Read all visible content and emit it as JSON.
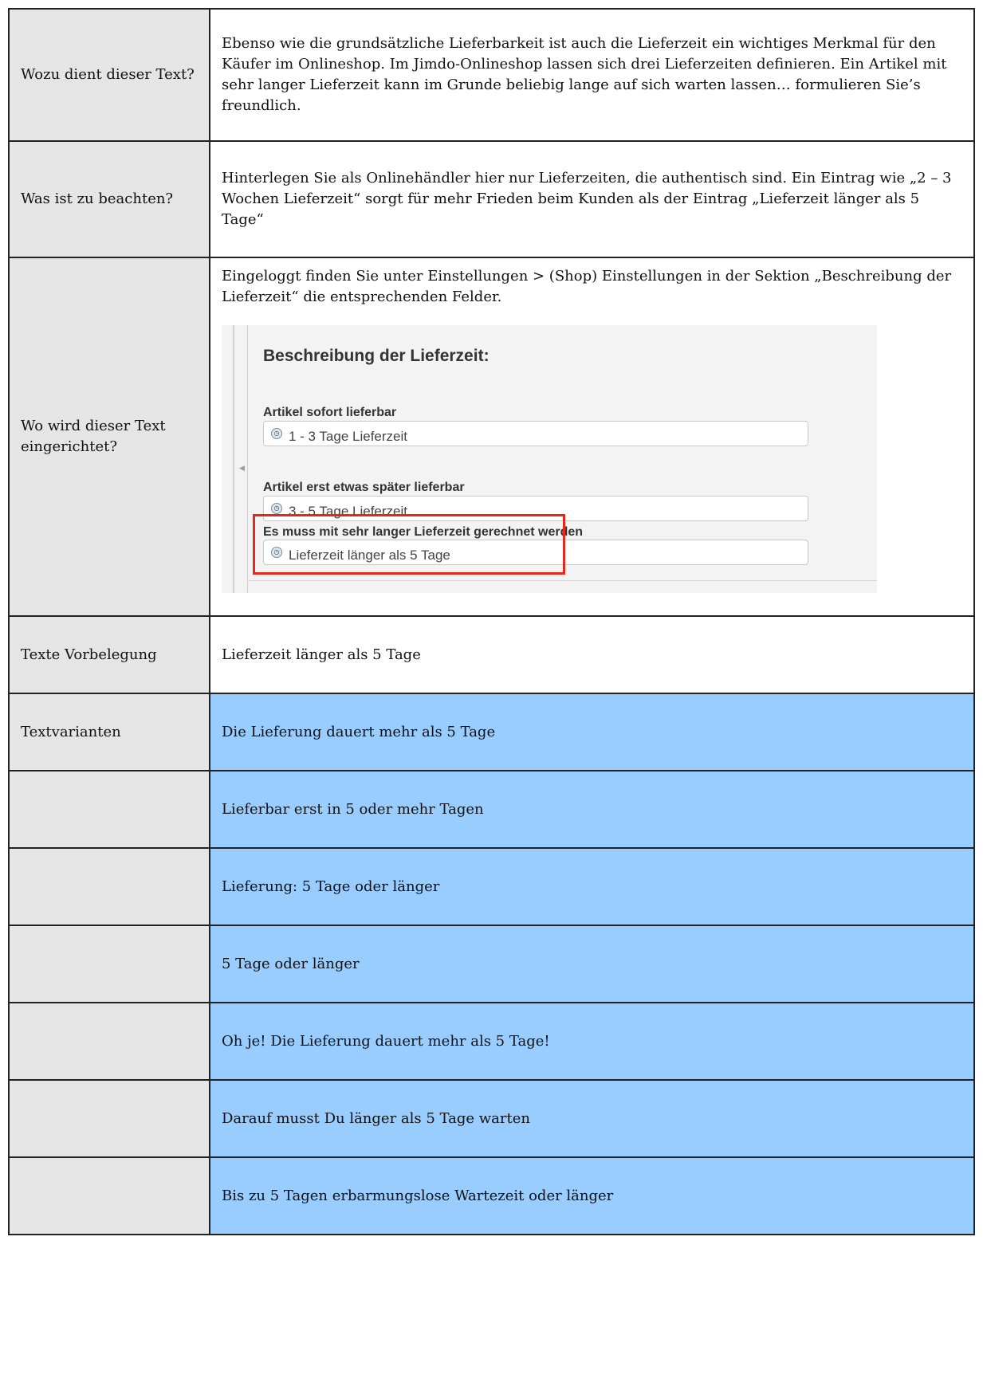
{
  "rows": {
    "purpose": {
      "label": "Wozu dient dieser Text?",
      "text": "Ebenso wie die grundsätzliche Lieferbarkeit ist auch die Lieferzeit ein wichtiges Merkmal für den Käufer im Onlineshop. Im Jimdo-Onlineshop lassen sich drei Lieferzeiten definieren. Ein Artikel mit sehr langer Lieferzeit kann im Grunde beliebig lange auf sich warten lassen… formulieren Sie’s freundlich."
    },
    "notes": {
      "label": "Was ist zu beachten?",
      "text": "Hinterlegen Sie als Onlinehändler hier nur Lieferzeiten, die authentisch sind. Ein Eintrag wie „2 – 3 Wochen Lieferzeit“ sorgt für mehr Frieden beim Kunden als der Eintrag „Lieferzeit länger als 5 Tage“"
    },
    "location": {
      "label": "Wo wird dieser Text eingerichtet?",
      "text": "Eingeloggt finden Sie unter Einstellungen > (Shop) Einstellungen in der Sektion „Beschreibung der Lieferzeit“ die entsprechenden Felder."
    },
    "default": {
      "label": "Texte Vorbelegung",
      "text": "Lieferzeit länger als 5 Tage"
    },
    "variants_label": "Textvarianten"
  },
  "screenshot": {
    "title": "Beschreibung der Lieferzeit:",
    "fields": [
      {
        "label": "Artikel sofort lieferbar",
        "value": "1 - 3 Tage Lieferzeit",
        "icon": "clock-icon"
      },
      {
        "label": "Artikel erst etwas später lieferbar",
        "value": "3 - 5 Tage Lieferzeit",
        "icon": "clock-icon"
      },
      {
        "label": "Es muss mit sehr langer Lieferzeit gerechnet werden",
        "value": "Lieferzeit länger als 5 Tage",
        "icon": "clock-icon"
      }
    ],
    "highlight_color": "#e4281b"
  },
  "variants": [
    "Die Lieferung dauert mehr als 5 Tage",
    "Lieferbar erst in 5 oder mehr Tagen",
    "Lieferung: 5 Tage oder länger",
    "5 Tage oder länger",
    "Oh je! Die Lieferung dauert mehr als 5 Tage!",
    "Darauf musst Du länger als 5 Tage warten",
    "Bis zu 5 Tagen erbarmungslose Wartezeit oder länger"
  ],
  "colors": {
    "label_grey": "#e5e5e5",
    "variant_blue": "#99ccff"
  }
}
